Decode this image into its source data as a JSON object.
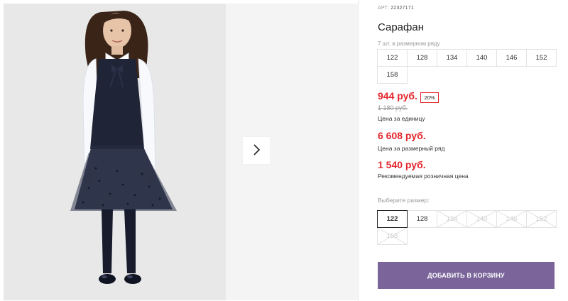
{
  "product": {
    "article_label": "АРТ:",
    "article_value": "22327171",
    "title": "Сарафан",
    "pack_label": "7 шт. в размерном ряду",
    "pack_sizes": [
      "122",
      "128",
      "134",
      "140",
      "146",
      "152",
      "158"
    ],
    "price": "944 руб.",
    "discount": "20%",
    "old_price": "1 180 руб.",
    "price_caption": "Цена за единицу",
    "pack_price": "6 608 руб.",
    "pack_price_caption": "Цена за размерный ряд",
    "retail_price": "1 540 руб.",
    "retail_caption": "Рекомендуемая розничная цена",
    "choose_label": "Выберите размер:",
    "choose_sizes": [
      {
        "label": "122",
        "state": "selected"
      },
      {
        "label": "128",
        "state": "available"
      },
      {
        "label": "134",
        "state": "unavailable"
      },
      {
        "label": "140",
        "state": "unavailable"
      },
      {
        "label": "146",
        "state": "unavailable"
      },
      {
        "label": "152",
        "state": "unavailable"
      },
      {
        "label": "158",
        "state": "unavailable"
      }
    ],
    "add_to_cart": "ДОБАВИТЬ В КОРЗИНУ"
  },
  "gallery": {
    "next_icon": "chevron-right-icon"
  },
  "colors": {
    "price_red": "#e4262c",
    "button_purple": "#7a649a",
    "dress_navy": "#1f2437"
  }
}
